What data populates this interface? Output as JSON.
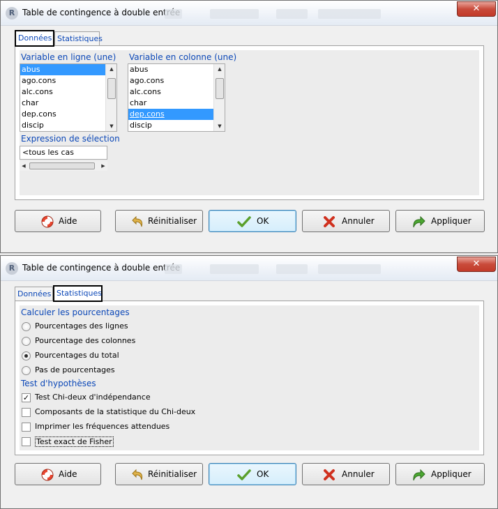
{
  "window": {
    "title": "Table de contingence à double entrée",
    "close_glyph": "✕",
    "r_logo": "R"
  },
  "tabs": {
    "data_label": "Données",
    "stats_label": "Statistiques"
  },
  "data_tab": {
    "row_var_label": "Variable en ligne (une)",
    "col_var_label": "Variable en colonne (une)",
    "row_items": [
      "abus",
      "ago.cons",
      "alc.cons",
      "char",
      "dep.cons",
      "discip"
    ],
    "col_items": [
      "abus",
      "ago.cons",
      "alc.cons",
      "char",
      "dep.cons",
      "discip"
    ],
    "row_selected": "abus",
    "col_selected": "dep.cons",
    "subset_label": "Expression de sélection",
    "subset_value": "<tous les cas valides>"
  },
  "stats_tab": {
    "pct_label": "Calculer les pourcentages",
    "pct_options": [
      {
        "label": "Pourcentages des lignes",
        "checked": false
      },
      {
        "label": "Pourcentage des colonnes",
        "checked": false
      },
      {
        "label": "Pourcentages du total",
        "checked": true
      },
      {
        "label": "Pas de pourcentages",
        "checked": false
      }
    ],
    "tests_label": "Test d'hypothèses",
    "tests": [
      {
        "label": "Test Chi-deux d'indépendance",
        "checked": true
      },
      {
        "label": "Composants de la statistique du Chi-deux",
        "checked": false
      },
      {
        "label": "Imprimer les fréquences attendues",
        "checked": false
      },
      {
        "label": "Test exact de Fisher",
        "checked": false
      }
    ]
  },
  "buttons": {
    "help": "Aide",
    "reset": "Réinitialiser",
    "ok": "OK",
    "cancel": "Annuler",
    "apply": "Appliquer"
  },
  "check_glyph": "✓",
  "colors": {
    "accent_blue": "#0b47b7",
    "selection": "#3399ff",
    "close_red": "#c94b3b"
  }
}
